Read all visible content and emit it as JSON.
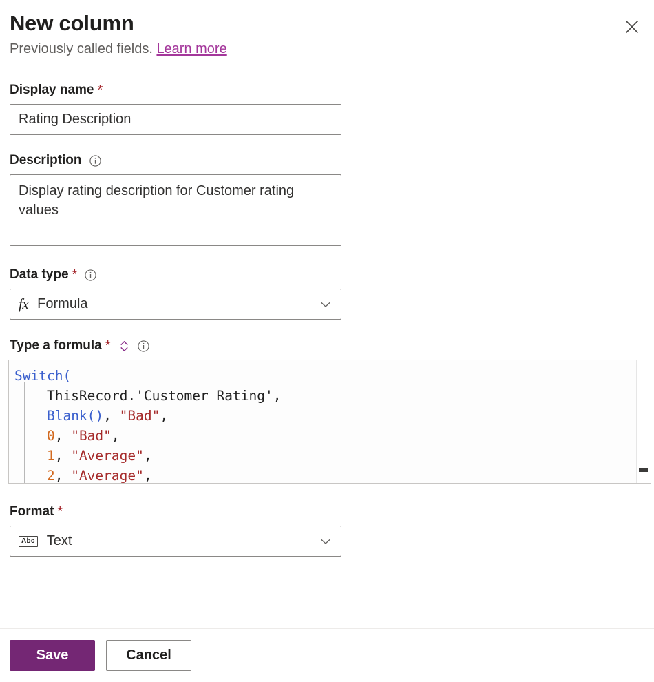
{
  "header": {
    "title": "New column",
    "subtitle_text": "Previously called fields.",
    "learn_more_label": "Learn more",
    "close_icon": "close-icon"
  },
  "fields": {
    "display_name": {
      "label": "Display name",
      "required_marker": "*",
      "value": "Rating Description",
      "placeholder": ""
    },
    "description": {
      "label": "Description",
      "info_icon": "info-icon",
      "value": "Display rating description for Customer rating values",
      "placeholder": ""
    },
    "data_type": {
      "label": "Data type",
      "required_marker": "*",
      "info_icon": "info-icon",
      "value": "Formula",
      "value_icon": "fx-icon",
      "chevron_icon": "chevron-down-icon"
    },
    "formula": {
      "label": "Type a formula",
      "required_marker": "*",
      "sort_icon": "expand-collapse-icon",
      "info_icon": "info-icon",
      "lines": [
        [
          {
            "t": "Switch(",
            "c": "fn"
          }
        ],
        [
          {
            "t": "    ThisRecord.",
            "c": "plain"
          },
          {
            "t": "'Customer Rating'",
            "c": "plain"
          },
          {
            "t": ",",
            "c": "plain"
          }
        ],
        [
          {
            "t": "    ",
            "c": "plain"
          },
          {
            "t": "Blank()",
            "c": "fn"
          },
          {
            "t": ", ",
            "c": "plain"
          },
          {
            "t": "\"Bad\"",
            "c": "str"
          },
          {
            "t": ",",
            "c": "plain"
          }
        ],
        [
          {
            "t": "    ",
            "c": "plain"
          },
          {
            "t": "0",
            "c": "num"
          },
          {
            "t": ", ",
            "c": "plain"
          },
          {
            "t": "\"Bad\"",
            "c": "str"
          },
          {
            "t": ",",
            "c": "plain"
          }
        ],
        [
          {
            "t": "    ",
            "c": "plain"
          },
          {
            "t": "1",
            "c": "num"
          },
          {
            "t": ", ",
            "c": "plain"
          },
          {
            "t": "\"Average\"",
            "c": "str"
          },
          {
            "t": ",",
            "c": "plain"
          }
        ],
        [
          {
            "t": "    ",
            "c": "plain"
          },
          {
            "t": "2",
            "c": "num"
          },
          {
            "t": ", ",
            "c": "plain"
          },
          {
            "t": "\"Average\"",
            "c": "str"
          },
          {
            "t": ",",
            "c": "plain"
          }
        ]
      ]
    },
    "format": {
      "label": "Format",
      "required_marker": "*",
      "value": "Text",
      "value_icon": "abc-icon",
      "value_icon_text": "Abc",
      "chevron_icon": "chevron-down-icon"
    }
  },
  "footer": {
    "save_label": "Save",
    "cancel_label": "Cancel"
  },
  "colors": {
    "primary": "#742774",
    "link": "#a4379b",
    "required": "#a4262c",
    "accent_sort": "#8a2d8a"
  }
}
